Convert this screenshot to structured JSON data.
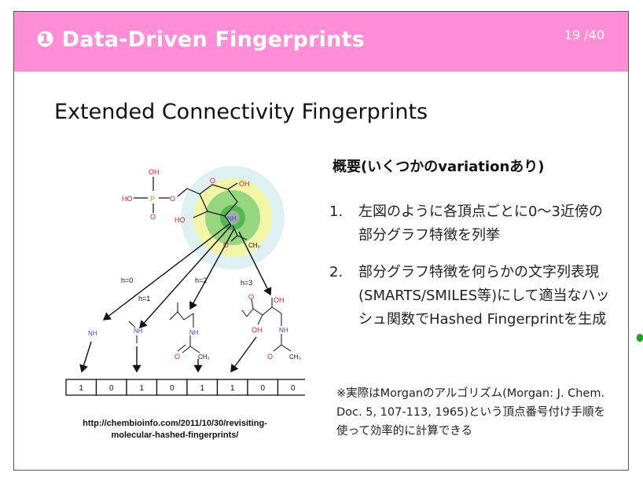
{
  "header": {
    "title": "❶ Data-Driven Fingerprints",
    "page": "19 /40",
    "color": "#ff8ed6"
  },
  "main_title": "Extended Connectivity Fingerprints",
  "figure": {
    "atom_labels": {
      "oh1": "OH",
      "p": "P",
      "ho_p": "HO",
      "o_p1": "O",
      "o_p2": "O",
      "oh_ring": "OH",
      "ho_ring": "HO",
      "ring_o": "O",
      "nh_center": "NH",
      "o_acetyl": "O",
      "ch3_center": "CH₃",
      "nh_h0": "NH",
      "nh_h1": "NH",
      "nh_h2": "NH",
      "o_h2": "O",
      "ch3_h2": "CH₃",
      "o_h3a": "O",
      "oh_h3a": "OH",
      "oh_h3b": "OH",
      "nh_h3": "NH",
      "o_h3b": "O",
      "ch3_h3": "CH₃"
    },
    "radius_labels": [
      "h=0",
      "h=1",
      "h=2",
      "h=3"
    ],
    "bits": [
      "1",
      "0",
      "1",
      "0",
      "1",
      "1",
      "0",
      "0"
    ],
    "caption": "http://chembioinfo.com/2011/10/30/revisiting-molecular-hashed-fingerprints/"
  },
  "summary": {
    "heading": "概要(いくつかのvariationあり)",
    "items": [
      {
        "num": "1.",
        "text": "左図のように各頂点ごとに0〜3近傍の部分グラフ特徴を列挙"
      },
      {
        "num": "2.",
        "text": "部分グラフ特徴を何らかの文字列表現(SMARTS/SMILES等)にして適当なハッシュ関数でHashed Fingerprintを生成"
      }
    ],
    "note": "※実際はMorganのアルゴリズム(Morgan: J. Chem. Doc. 5, 107-113, 1965)という頂点番号付け手順を使って効率的に計算できる"
  },
  "colors": {
    "oxygen": "#d22",
    "nitrogen": "#44c",
    "phosphorus": "#d80",
    "circle_outer": "#dff0f2",
    "circle_mid": "#f1f5a6",
    "circle_inner": "#96d67e",
    "circle_core": "#52b852"
  }
}
